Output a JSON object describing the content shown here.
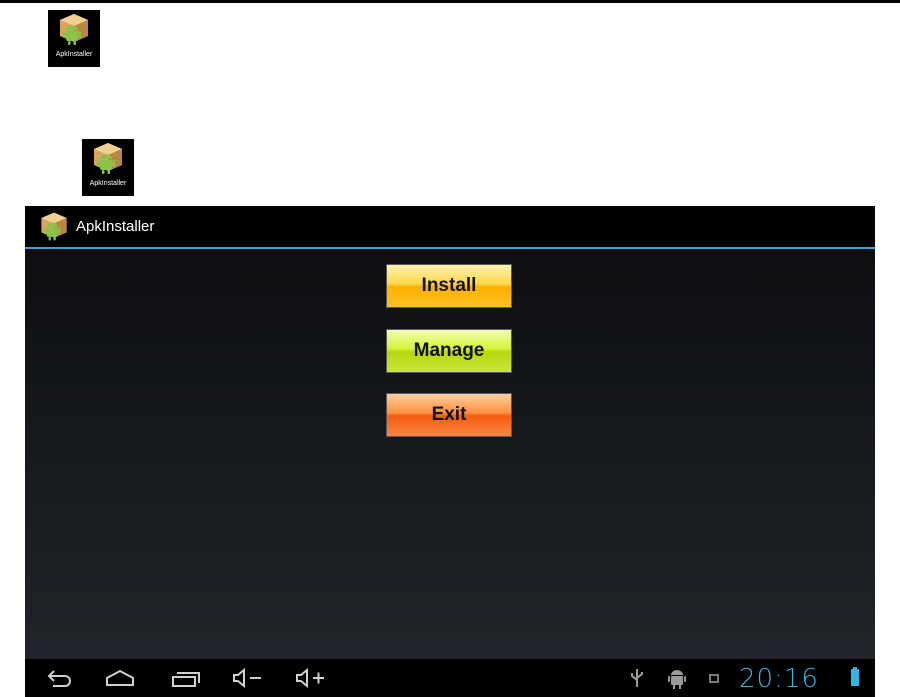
{
  "launcher": {
    "icon_label_1": "ApkInstaller",
    "icon_label_2": "ApkInstaller"
  },
  "app": {
    "title": "ApkInstaller",
    "accent_color": "#33b5e5"
  },
  "buttons": {
    "install": "Install",
    "manage": "Manage",
    "exit": "Exit"
  },
  "status": {
    "time": "20:16"
  },
  "icons": [
    "box-android-icon",
    "back-icon",
    "home-icon",
    "recent-apps-icon",
    "volume-down-icon",
    "volume-up-icon",
    "usb-icon",
    "android-debug-icon",
    "notification-icon",
    "battery-icon"
  ]
}
